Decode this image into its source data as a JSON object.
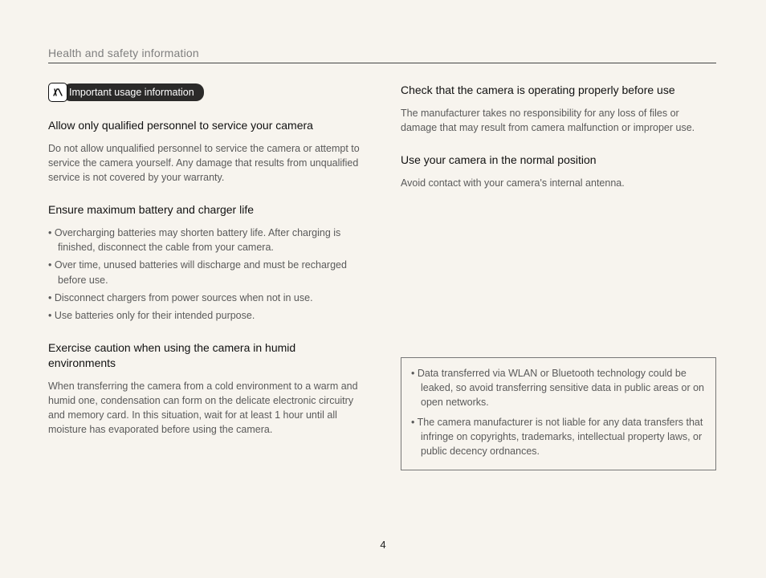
{
  "header": "Health and safety information",
  "badge": {
    "label": "Important usage information"
  },
  "left": {
    "s1": {
      "title": "Allow only qualified personnel to service your camera",
      "body": "Do not allow unqualified personnel to service the camera or attempt to service the camera yourself. Any damage that results from unqualified service is not covered by your warranty."
    },
    "s2": {
      "title": "Ensure maximum battery and charger life",
      "items": [
        "Overcharging batteries may shorten battery life. After charging is finished, disconnect the cable from your camera.",
        "Over time, unused batteries will discharge and must be recharged before use.",
        "Disconnect chargers from power sources when not in use.",
        "Use batteries only for their intended purpose."
      ]
    },
    "s3": {
      "title": "Exercise caution when using the camera in humid environments",
      "body": "When transferring the camera from a cold environment to a warm and humid one, condensation can form on the delicate electronic circuitry and memory card. In this situation, wait for at least 1 hour until all moisture has evaporated before using the camera."
    }
  },
  "right": {
    "s1": {
      "title": "Check that the camera is operating properly before use",
      "body": "The manufacturer takes no responsibility for any loss of files or damage that may result from camera malfunction or improper use."
    },
    "s2": {
      "title": "Use your camera in the normal position",
      "body": "Avoid contact with your camera's internal antenna."
    },
    "box": {
      "items": [
        "Data transferred via WLAN or Bluetooth technology could be leaked, so avoid transferring sensitive data in public areas or on open networks.",
        "The camera manufacturer is not liable for any data transfers that infringe on copyrights, trademarks, intellectual property laws, or public decency ordnances."
      ]
    }
  },
  "page_number": "4"
}
